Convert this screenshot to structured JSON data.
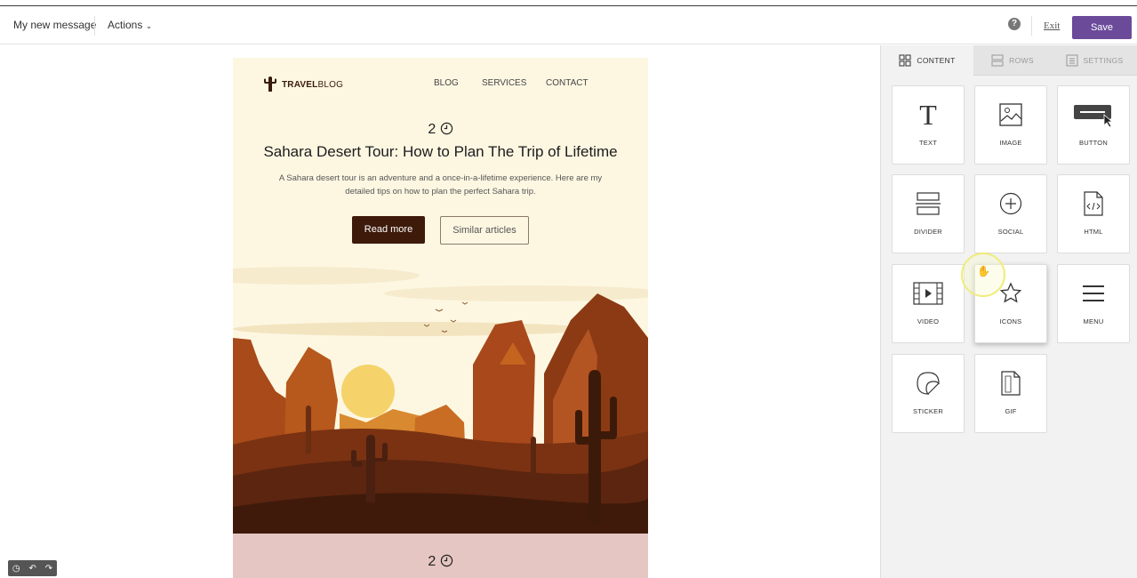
{
  "toolbar": {
    "message_title": "My new message",
    "actions_label": "Actions",
    "help_icon": "?",
    "exit_label": "Exit",
    "save_label": "Save",
    "accent_color": "#6b4a9a"
  },
  "email": {
    "logo_bold": "TRAVEL",
    "logo_light": "BLOG",
    "nav": [
      "BLOG",
      "SERVICES",
      "CONTACT"
    ],
    "read_time": "2",
    "headline": "Sahara Desert Tour: How to Plan The Trip of Lifetime",
    "lead": "A Sahara desert tour is an adventure and a once-in-a-lifetime experience. Here are my detailed tips on how to plan the perfect Sahara trip.",
    "primary_button": "Read more",
    "secondary_button": "Similar articles",
    "next_read_time": "2",
    "background_color": "#fdf7e2"
  },
  "panel": {
    "tabs": [
      {
        "label": "CONTENT",
        "icon": "grid-icon",
        "active": true
      },
      {
        "label": "ROWS",
        "icon": "rows-icon",
        "active": false
      },
      {
        "label": "SETTINGS",
        "icon": "settings-icon",
        "active": false
      }
    ],
    "tiles": [
      {
        "label": "TEXT",
        "icon": "text-icon"
      },
      {
        "label": "IMAGE",
        "icon": "image-icon"
      },
      {
        "label": "BUTTON",
        "icon": "button-icon"
      },
      {
        "label": "DIVIDER",
        "icon": "divider-icon"
      },
      {
        "label": "SOCIAL",
        "icon": "social-icon"
      },
      {
        "label": "HTML",
        "icon": "html-icon"
      },
      {
        "label": "VIDEO",
        "icon": "video-icon"
      },
      {
        "label": "ICONS",
        "icon": "star-icon"
      },
      {
        "label": "MENU",
        "icon": "menu-icon"
      },
      {
        "label": "STICKER",
        "icon": "sticker-icon"
      },
      {
        "label": "GIF",
        "icon": "gif-icon"
      }
    ]
  }
}
